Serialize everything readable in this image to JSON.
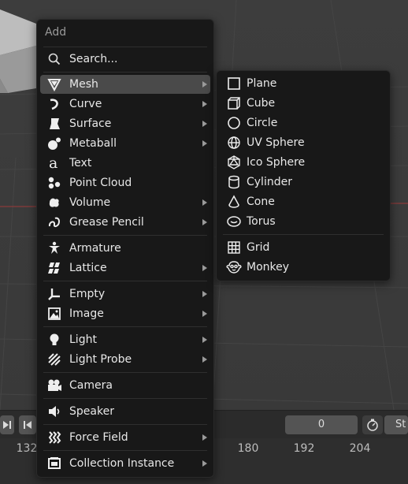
{
  "add_menu": {
    "title": "Add",
    "search": {
      "label": "Search...",
      "icon": "search-icon"
    },
    "items": [
      {
        "label": "Mesh",
        "icon": "mesh-icon",
        "submenu": true,
        "active": true
      },
      {
        "label": "Curve",
        "icon": "curve-icon",
        "submenu": true
      },
      {
        "label": "Surface",
        "icon": "surface-icon",
        "submenu": true
      },
      {
        "label": "Metaball",
        "icon": "metaball-icon",
        "submenu": true
      },
      {
        "label": "Text",
        "icon": "text-icon",
        "submenu": false
      },
      {
        "label": "Point Cloud",
        "icon": "point-cloud-icon",
        "submenu": false
      },
      {
        "label": "Volume",
        "icon": "volume-icon",
        "submenu": true
      },
      {
        "label": "Grease Pencil",
        "icon": "grease-pencil-icon",
        "submenu": true
      },
      {
        "label": "Armature",
        "icon": "armature-icon",
        "submenu": false
      },
      {
        "label": "Lattice",
        "icon": "lattice-icon",
        "submenu": true
      },
      {
        "label": "Empty",
        "icon": "empty-icon",
        "submenu": true
      },
      {
        "label": "Image",
        "icon": "image-icon",
        "submenu": true
      },
      {
        "label": "Light",
        "icon": "light-icon",
        "submenu": true
      },
      {
        "label": "Light Probe",
        "icon": "light-probe-icon",
        "submenu": true
      },
      {
        "label": "Camera",
        "icon": "camera-icon",
        "submenu": false
      },
      {
        "label": "Speaker",
        "icon": "speaker-icon",
        "submenu": false
      },
      {
        "label": "Force Field",
        "icon": "force-field-icon",
        "submenu": true
      },
      {
        "label": "Collection Instance",
        "icon": "collection-icon",
        "submenu": true
      }
    ]
  },
  "mesh_submenu": {
    "items": [
      {
        "label": "Plane",
        "icon": "plane-icon"
      },
      {
        "label": "Cube",
        "icon": "cube-icon"
      },
      {
        "label": "Circle",
        "icon": "circle-icon"
      },
      {
        "label": "UV Sphere",
        "icon": "uv-sphere-icon"
      },
      {
        "label": "Ico Sphere",
        "icon": "ico-sphere-icon"
      },
      {
        "label": "Cylinder",
        "icon": "cylinder-icon"
      },
      {
        "label": "Cone",
        "icon": "cone-icon"
      },
      {
        "label": "Torus",
        "icon": "torus-icon"
      },
      {
        "label": "Grid",
        "icon": "grid-icon"
      },
      {
        "label": "Monkey",
        "icon": "monkey-icon"
      }
    ]
  },
  "timeline": {
    "current_frame": "0",
    "frame_numbers": [
      "132",
      "180",
      "192",
      "204"
    ],
    "truncated_label": "St"
  },
  "colors": {
    "menu_bg": "#181818",
    "active_item": "#4a4a4a",
    "text": "#e8e8e8",
    "title_text": "#9a9a9a"
  }
}
